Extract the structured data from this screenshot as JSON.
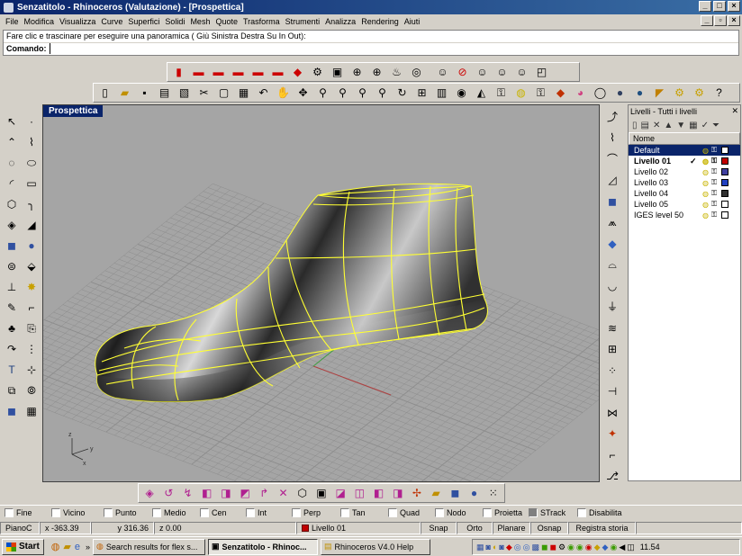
{
  "titlebar": {
    "title": "Senzatitolo - Rhinoceros (Valutazione) - [Prospettica]"
  },
  "menu": [
    "File",
    "Modifica",
    "Visualizza",
    "Curve",
    "Superfici",
    "Solidi",
    "Mesh",
    "Quote",
    "Trasforma",
    "Strumenti",
    "Analizza",
    "Rendering",
    "Aiuti"
  ],
  "command": {
    "history": "Fare clic e trascinare per eseguire una panoramica ( Giù  Sinistra  Destra  Su  In  Out):",
    "prompt_label": "Comando:",
    "value": ""
  },
  "viewport": {
    "title": "Prospettica"
  },
  "layers": {
    "panel_title": "Livelli - Tutti i livelli",
    "column_header": "Nome",
    "rows": [
      {
        "name": "Default",
        "current": false,
        "selected": true,
        "color": "#ffffff"
      },
      {
        "name": "Livello 01",
        "current": true,
        "selected": false,
        "color": "#c00000"
      },
      {
        "name": "Livello 02",
        "current": false,
        "selected": false,
        "color": "#4040a0"
      },
      {
        "name": "Livello 03",
        "current": false,
        "selected": false,
        "color": "#2040c0"
      },
      {
        "name": "Livello 04",
        "current": false,
        "selected": false,
        "color": "#303030"
      },
      {
        "name": "Livello 05",
        "current": false,
        "selected": false,
        "color": "#ffffff"
      },
      {
        "name": "IGES level 50",
        "current": false,
        "selected": false,
        "color": "#ffffff"
      }
    ],
    "check_mark": "✓"
  },
  "osnap": [
    {
      "label": "Fine",
      "checked": false
    },
    {
      "label": "Vicino",
      "checked": false
    },
    {
      "label": "Punto",
      "checked": false
    },
    {
      "label": "Medio",
      "checked": false
    },
    {
      "label": "Cen",
      "checked": false
    },
    {
      "label": "Int",
      "checked": false
    },
    {
      "label": "Perp",
      "checked": false
    },
    {
      "label": "Tan",
      "checked": false
    },
    {
      "label": "Quad",
      "checked": false
    },
    {
      "label": "Nodo",
      "checked": false
    },
    {
      "label": "Proietta",
      "checked": false
    },
    {
      "label": "STrack",
      "checked": true
    },
    {
      "label": "Disabilita",
      "checked": false
    }
  ],
  "status": {
    "cplane": "PianoC",
    "x": "x -363.39",
    "y": "y 316.36",
    "z": "z 0.00",
    "layer": "Livello 01",
    "snap": "Snap",
    "ortho": "Orto",
    "planar": "Planare",
    "osnap": "Osnap",
    "history": "Registra storia"
  },
  "taskbar": {
    "start": "Start",
    "tasks": [
      {
        "label": "Search results for flex s...",
        "active": false
      },
      {
        "label": "Senzatitolo - Rhinoc...",
        "active": true
      },
      {
        "label": "Rhinoceros V4.0 Help",
        "active": false
      }
    ],
    "clock": "11.54"
  },
  "colors": {
    "titlebar": "#0a246a",
    "viewport_bg": "#a5a5a5",
    "wireframe": "#ffff33",
    "grid": "#8c8c8c",
    "x_axis": "#b04040",
    "y_axis": "#40a040"
  }
}
